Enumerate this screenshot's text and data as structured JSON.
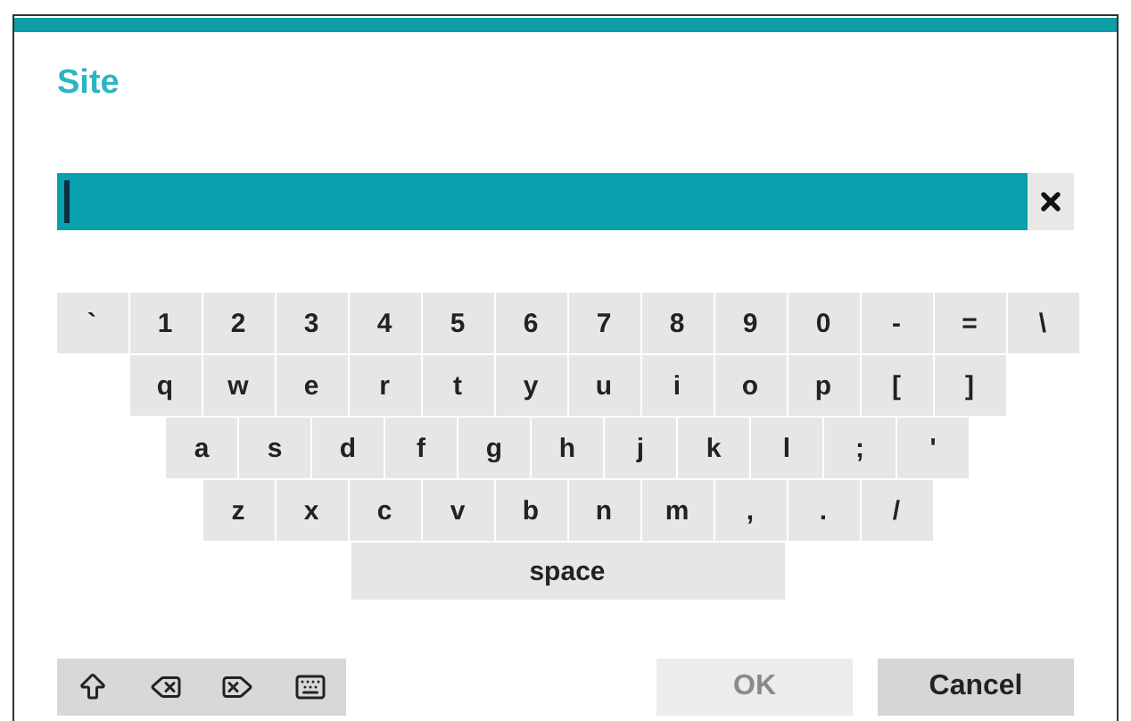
{
  "dialog": {
    "title": "Site"
  },
  "keyboard": {
    "key_rows": [
      {
        "keys": [
          "`",
          "1",
          "2",
          "3",
          "4",
          "5",
          "6",
          "7",
          "8",
          "9",
          "0",
          "-",
          "=",
          "\\"
        ]
      },
      {
        "keys": [
          "q",
          "w",
          "e",
          "r",
          "t",
          "y",
          "u",
          "i",
          "o",
          "p",
          "[",
          "]"
        ]
      },
      {
        "keys": [
          "a",
          "s",
          "d",
          "f",
          "g",
          "h",
          "j",
          "k",
          "l",
          ";",
          "'"
        ]
      },
      {
        "keys": [
          "z",
          "x",
          "c",
          "v",
          "b",
          "n",
          "m",
          ",",
          ".",
          "/"
        ]
      }
    ],
    "space_key": "space"
  },
  "buttons": [
    {
      "label": "OK",
      "disabled": true
    },
    {
      "label": "Cancel",
      "disabled": false
    }
  ]
}
